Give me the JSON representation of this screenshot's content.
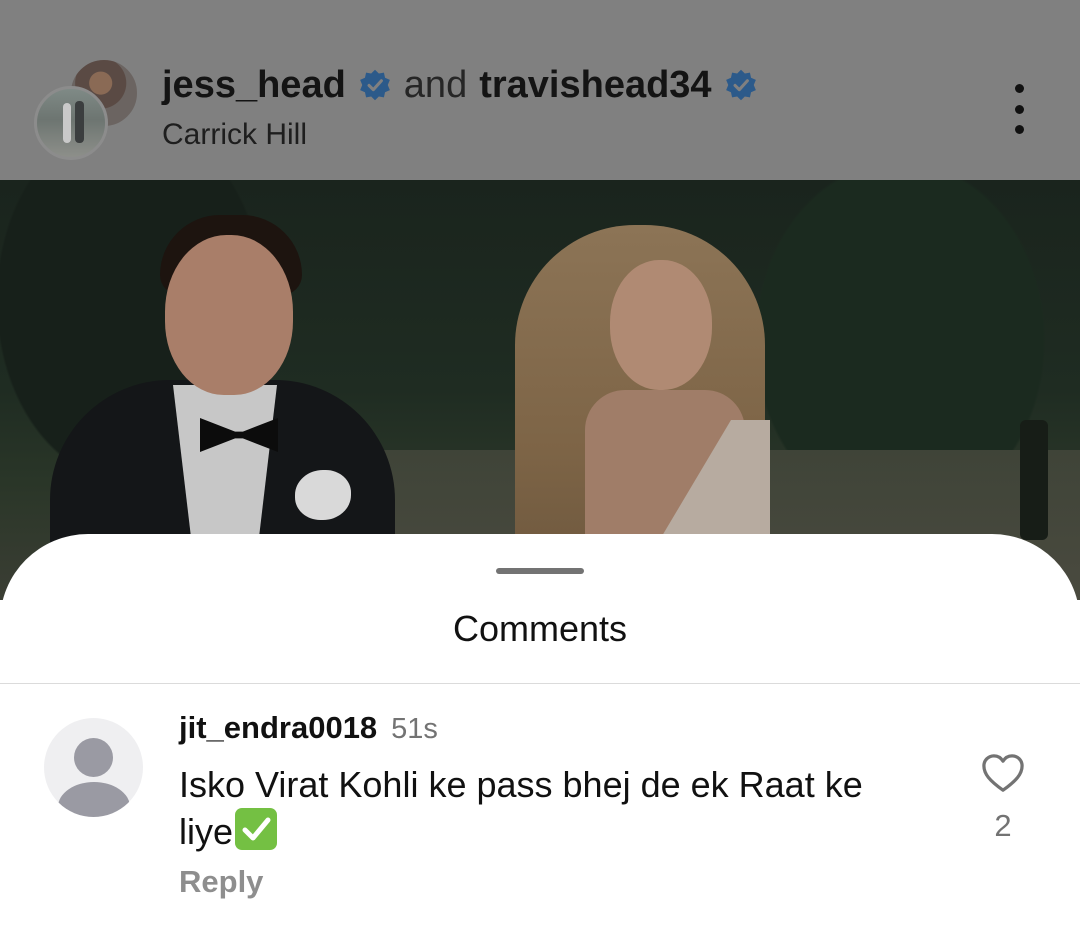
{
  "post": {
    "user1": "jess_head",
    "connector": "and",
    "user2": "travishead34",
    "location": "Carrick Hill",
    "more_icon": "more-vertical-icon"
  },
  "sheet": {
    "title": "Comments"
  },
  "comments": [
    {
      "username": "jit_endra0018",
      "time": "51s",
      "text": "Isko Virat Kohli ke pass bhej de ek Raat ke liye",
      "emoji": "✅",
      "reply_label": "Reply",
      "like_count": "2"
    }
  ],
  "colors": {
    "verified": "#3897f0",
    "checkmark_emoji": "#74c043"
  }
}
